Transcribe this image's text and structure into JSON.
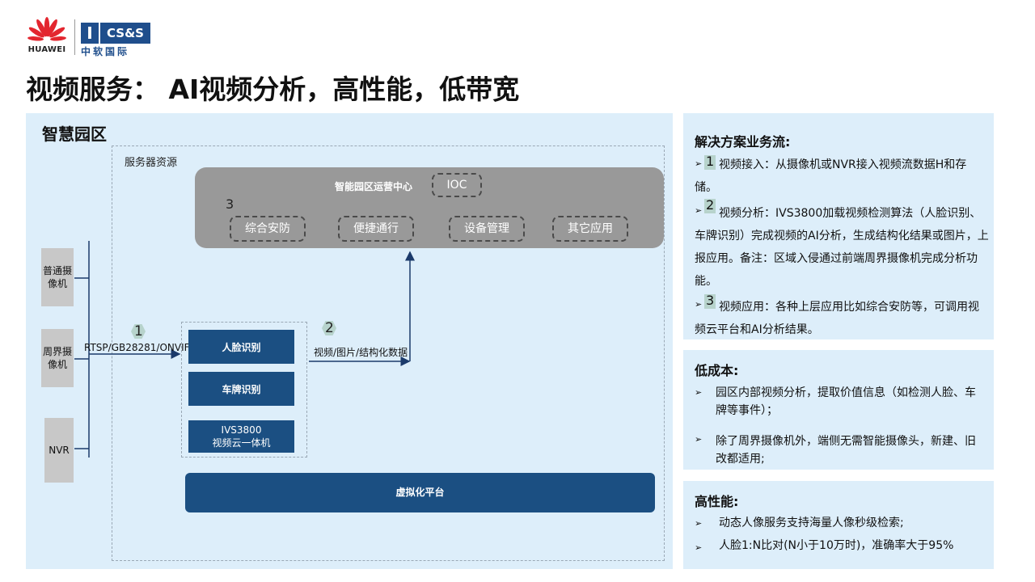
{
  "header": {
    "brand_huawei": "HUAWEI",
    "brand_cs_mark": "I",
    "brand_cs": "CS&S",
    "brand_cs_cn": "中软国际",
    "title": "视频服务： AI视频分析，高性能，低带宽"
  },
  "diagram": {
    "park_title": "智慧园区",
    "server_label": "服务器资源",
    "ioc_center": "智能园区运营中心",
    "ioc_tag": "IOC",
    "apps": [
      "综合安防",
      "便捷通行",
      "设备管理",
      "其它应用"
    ],
    "cameras": [
      "普通摄像机",
      "周界摄像机",
      "NVR"
    ],
    "protocol": "RTSP/GB28281/ONVIF",
    "algorithms": [
      "人脸识别",
      "车牌识别"
    ],
    "ivs_line1": "IVS3800",
    "ivs_line2": "视频云一体机",
    "data_flow": "视频/图片/结构化数据",
    "virtualization": "虚拟化平台",
    "steps": [
      "1",
      "2",
      "3"
    ]
  },
  "panels": {
    "flow": {
      "title": "解决方案业务流:",
      "items": [
        {
          "num": "1",
          "text": "视频接入：从摄像机或NVR接入视频流数据H和存储。"
        },
        {
          "num": "2",
          "text": "视频分析：IVS3800加载视频检测算法（人脸识别、车牌识别）完成视频的AI分析，生成结构化结果或图片，上报应用。备注：区域入侵通过前端周界摄像机完成分析功能。"
        },
        {
          "num": "3",
          "text": "视频应用：各种上层应用比如综合安防等，可调用视频云平台和AI分析结果。"
        }
      ]
    },
    "low_cost": {
      "title": "低成本:",
      "items": [
        "园区内部视频分析，提取价值信息（如检测人脸、车牌等事件）；",
        "除了周界摄像机外，端侧无需智能摄像头，新建、旧改都适用;"
      ]
    },
    "high_perf": {
      "title": "高性能:",
      "items": [
        "动态人像服务支持海量人像秒级检索;",
        "人脸1:N比对(N小于10万时)，准确率大于95%"
      ]
    }
  },
  "colors": {
    "panel_bg": "#ddeefa",
    "dark_blue": "#1b4f82",
    "gray": "#999999",
    "badge": "#b7d3cc"
  },
  "icons": {
    "bullet": "arrow-bullet-icon",
    "logo": "huawei-flower-icon"
  }
}
